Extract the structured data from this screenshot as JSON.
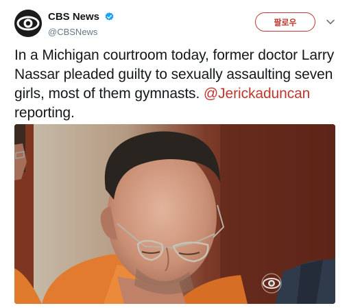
{
  "account": {
    "name": "CBS News",
    "handle": "@CBSNews",
    "avatar_icon": "cbs-eye-logo-icon",
    "verified_icon": "verified-badge-icon"
  },
  "follow_label": "팔로우",
  "menu_icon": "chevron-down-icon",
  "tweet": {
    "text_before": "In a Michigan courtroom today, former doctor Larry Nassar pleaded guilty to sexually assaulting seven girls, most of them gymnasts. ",
    "mention": "@Jerickaduncan",
    "text_after": " reporting."
  },
  "media": {
    "watermark_icon": "cbs-eye-watermark-icon"
  },
  "colors": {
    "accent": "#c0362c",
    "verified": "#1da1f2",
    "text": "#14171a",
    "secondary": "#657786"
  }
}
